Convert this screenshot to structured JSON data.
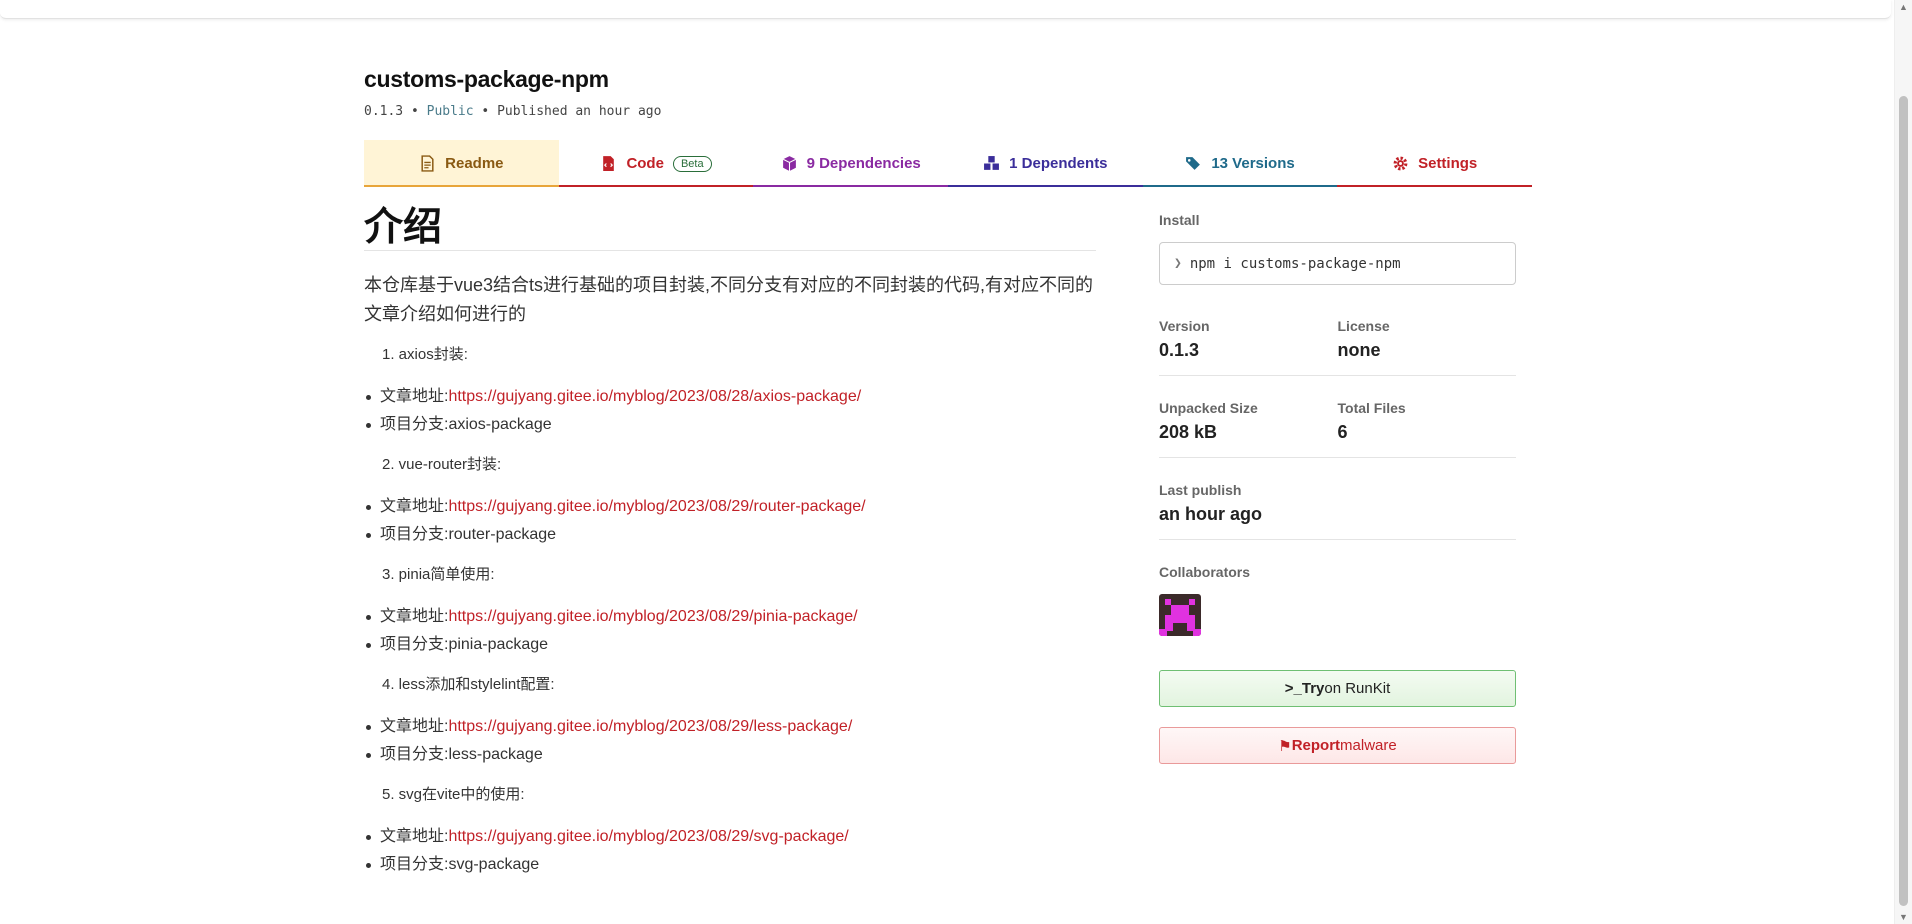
{
  "package": {
    "name": "customs-package-npm",
    "version": "0.1.3",
    "sep1": " • ",
    "visibility": "Public",
    "sep2": " • ",
    "published": "Published an hour ago"
  },
  "tabs": [
    {
      "label": "Readme",
      "icon": "readme-icon"
    },
    {
      "label": "Code",
      "badge": "Beta",
      "icon": "code-file-icon"
    },
    {
      "label": "9 Dependencies",
      "icon": "box-icon"
    },
    {
      "label": "1 Dependents",
      "icon": "boxes-icon"
    },
    {
      "label": "13 Versions",
      "icon": "tags-icon"
    },
    {
      "label": "Settings",
      "icon": "gear-icon"
    }
  ],
  "tab_colors": [
    "#e8a53a",
    "#c12127",
    "#8a2aa2",
    "#3b2e9a",
    "#1f6a8a",
    "#c12127"
  ],
  "readme": {
    "heading": "介绍",
    "intro": "本仓库基于vue3结合ts进行基础的项目封装,不同分支有对应的不同封装的代码,有对应不同的文章介绍如何进行的",
    "sections": [
      {
        "title": "1. axios封装:",
        "article_label": "文章地址:",
        "article_url": "https://gujyang.gitee.io/myblog/2023/08/28/axios-package/",
        "branch": "项目分支:axios-package"
      },
      {
        "title": "2. vue-router封装:",
        "article_label": "文章地址:",
        "article_url": "https://gujyang.gitee.io/myblog/2023/08/29/router-package/",
        "branch": "项目分支:router-package"
      },
      {
        "title": "3. pinia简单使用:",
        "article_label": "文章地址:",
        "article_url": "https://gujyang.gitee.io/myblog/2023/08/29/pinia-package/",
        "branch": "项目分支:pinia-package"
      },
      {
        "title": "4. less添加和stylelint配置:",
        "article_label": "文章地址:",
        "article_url": "https://gujyang.gitee.io/myblog/2023/08/29/less-package/",
        "branch": "项目分支:less-package"
      },
      {
        "title": "5. svg在vite中的使用:",
        "article_label": "文章地址:",
        "article_url": "https://gujyang.gitee.io/myblog/2023/08/29/svg-package/",
        "branch": "项目分支:svg-package"
      }
    ]
  },
  "sidebar": {
    "install_label": "Install",
    "install_command": "npm i customs-package-npm",
    "version_label": "Version",
    "version_value": "0.1.3",
    "license_label": "License",
    "license_value": "none",
    "unpacked_label": "Unpacked Size",
    "unpacked_value": "208 kB",
    "files_label": "Total Files",
    "files_value": "6",
    "last_publish_label": "Last publish",
    "last_publish_value": "an hour ago",
    "collaborators_label": "Collaborators",
    "runkit_prefix": ">_",
    "runkit_try": "Try",
    "runkit_suffix": " on RunKit",
    "report_bold": "Report",
    "report_suffix": " malware"
  }
}
